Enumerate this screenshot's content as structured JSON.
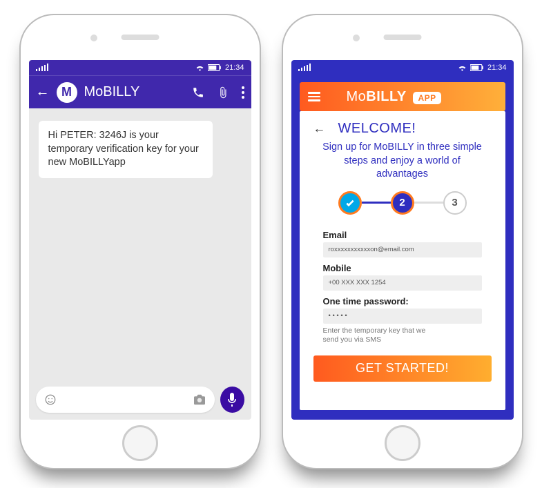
{
  "status": {
    "time": "21:34"
  },
  "sms": {
    "contact_initial": "M",
    "contact_name": "MoBILLY",
    "message": "Hi PETER: 3246J is your temporary verification key for your new MoBILLYapp",
    "input_value": ""
  },
  "app": {
    "brand_mo": "Mo",
    "brand_billy": "BILLY",
    "brand_badge": "APP",
    "welcome": "WELCOME!",
    "tagline": "Sign up for MoBILLY in three simple steps and enjoy a world of advantages",
    "steps": {
      "s1": "✓",
      "s2": "2",
      "s3": "3"
    },
    "form": {
      "email_label": "Email",
      "email_value": "roxxxxxxxxxxxon@email.com",
      "mobile_label": "Mobile",
      "mobile_value": "+00 XXX XXX 1254",
      "otp_label": "One time password:",
      "otp_value": "• • • • •",
      "otp_hint": "Enter the temporary key that we send you via SMS"
    },
    "cta": "GET STARTED!"
  }
}
